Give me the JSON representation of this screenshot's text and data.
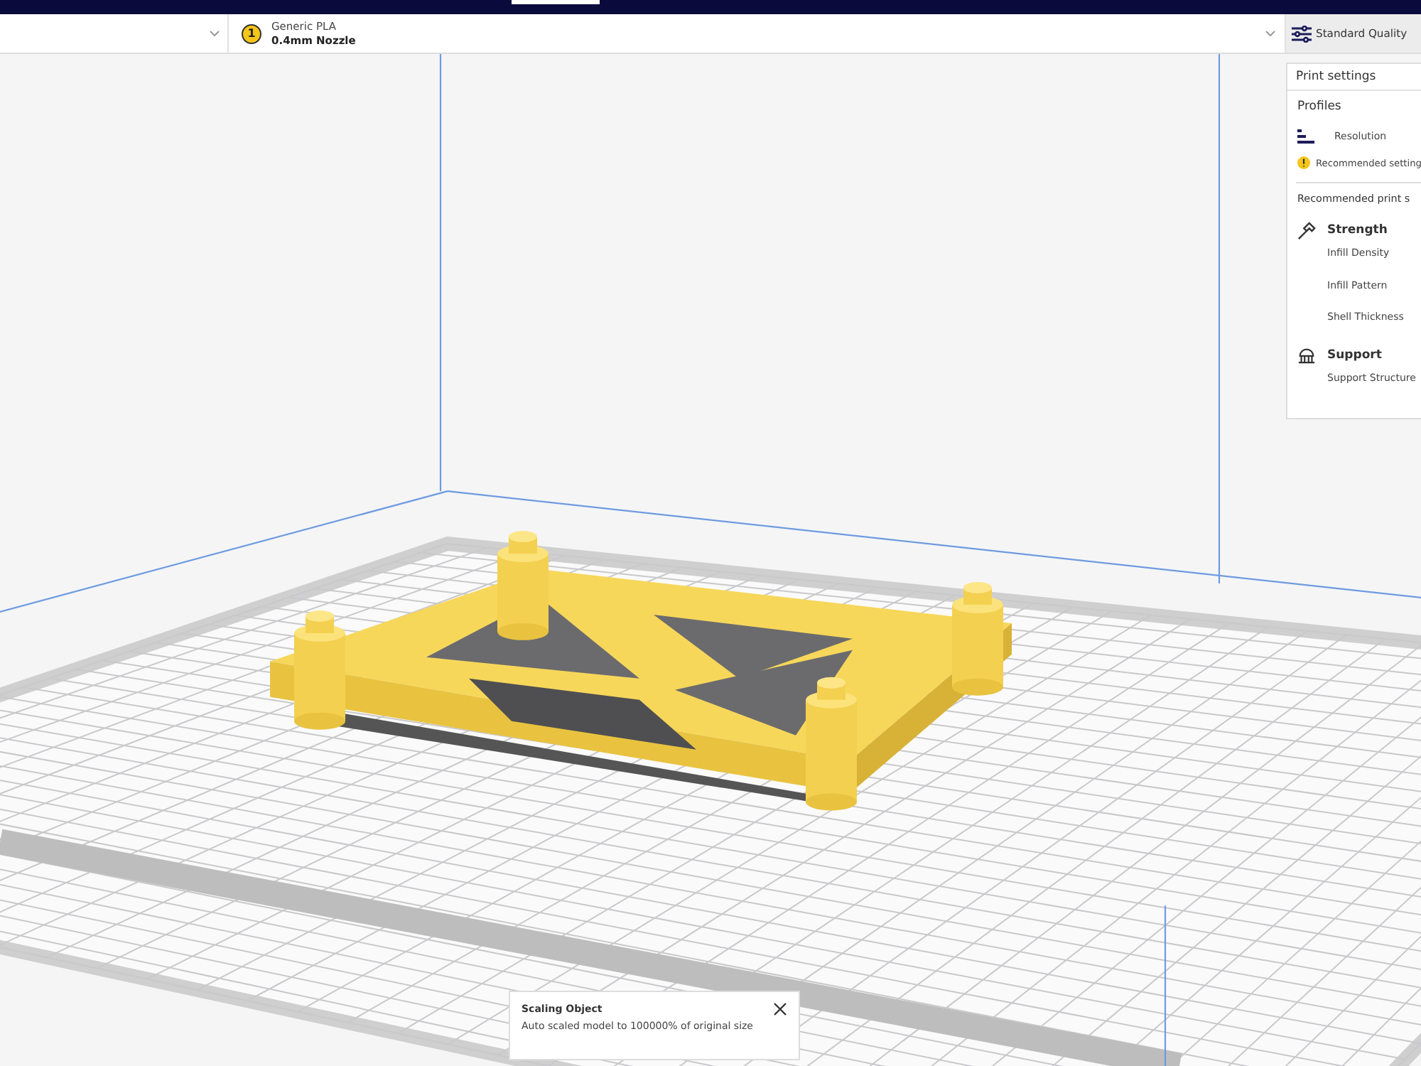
{
  "material": {
    "badge": "1",
    "name": "Generic PLA",
    "nozzle": "0.4mm Nozzle"
  },
  "quality": {
    "label": "Standard Quality"
  },
  "print_settings": {
    "title": "Print settings",
    "profiles_label": "Profiles",
    "resolution_label": "Resolution",
    "note": "Recommended setting",
    "section_title": "Recommended print s",
    "groups": [
      {
        "kind": "strength",
        "title": "Strength",
        "items": [
          "Infill Density",
          "Infill Pattern",
          "Shell Thickness"
        ]
      },
      {
        "kind": "support",
        "title": "Support",
        "items": [
          "Support Structure"
        ]
      }
    ]
  },
  "notification": {
    "title": "Scaling Object",
    "message": "Auto scaled model to 100000% of original size"
  }
}
